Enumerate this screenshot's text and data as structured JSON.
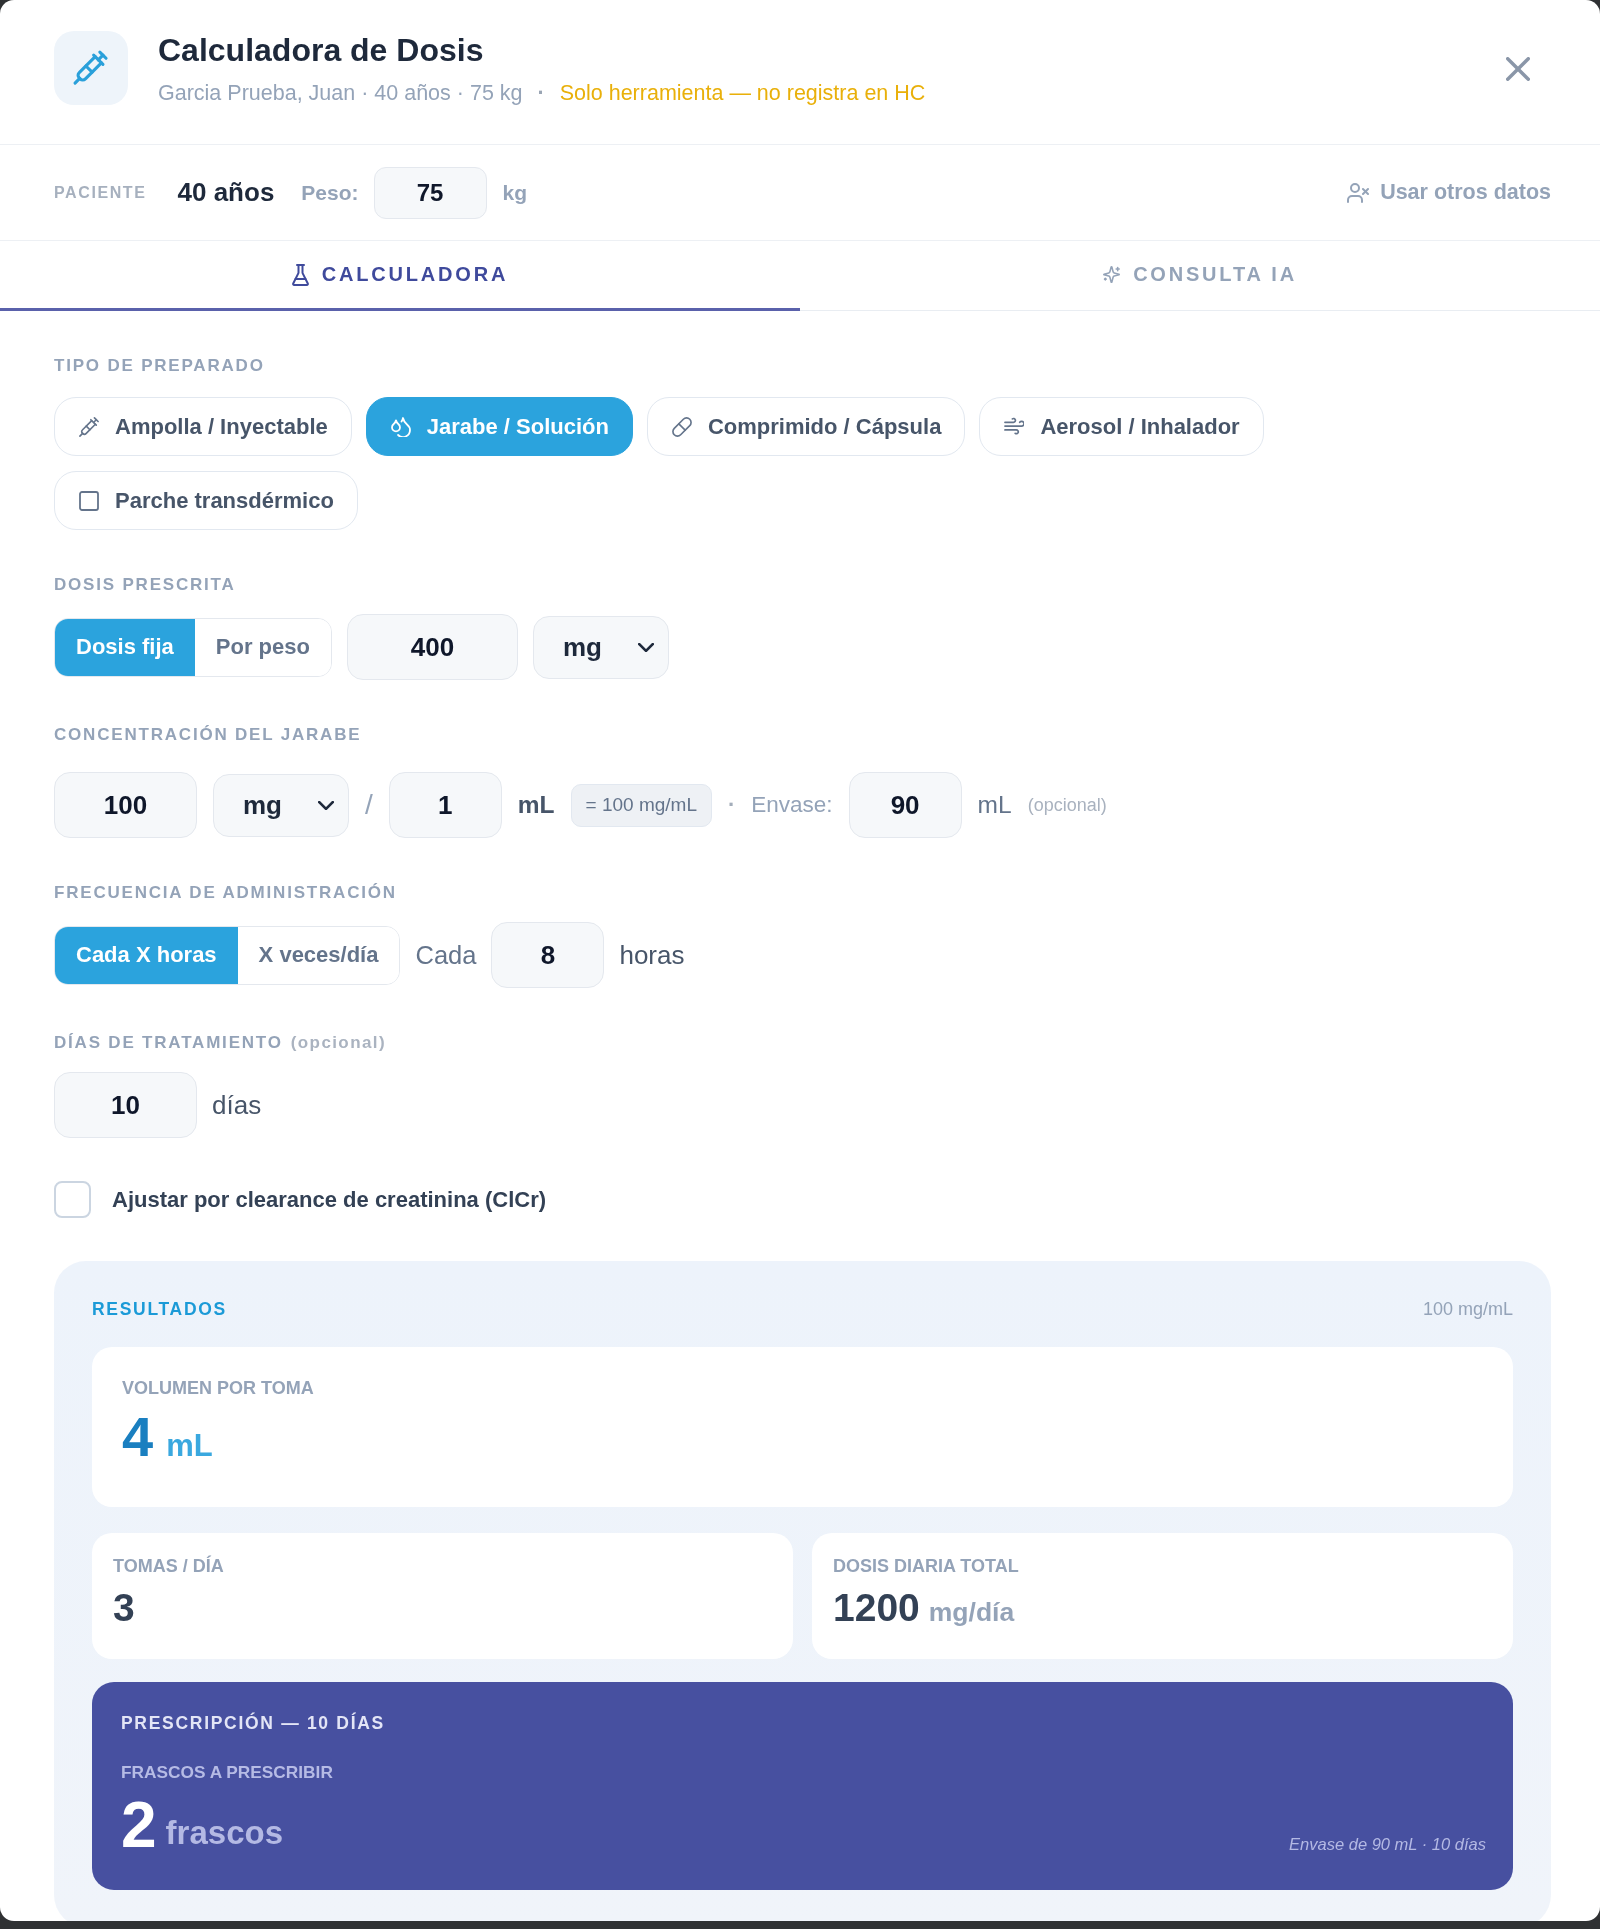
{
  "header": {
    "title": "Calculadora de Dosis",
    "patient_summary": "Garcia Prueba, Juan · 40 años · 75 kg",
    "separator": "·",
    "notice": "Solo herramienta — no registra en HC"
  },
  "patient_bar": {
    "label": "PACIENTE",
    "age": "40 años",
    "weight_label": "Peso:",
    "weight": "75",
    "weight_unit": "kg",
    "other_data_button": "Usar otros datos"
  },
  "tabs": [
    {
      "kind": "calculator",
      "label": "CALCULADORA",
      "selected": true
    },
    {
      "kind": "ai",
      "label": "CONSULTA IA",
      "selected": false
    }
  ],
  "preparation": {
    "label": "TIPO DE PREPARADO",
    "options": [
      {
        "kind": "injectable",
        "label": "Ampolla / Inyectable",
        "selected": false
      },
      {
        "kind": "syrup",
        "label": "Jarabe / Solución",
        "selected": true
      },
      {
        "kind": "tablet",
        "label": "Comprimido / Cápsula",
        "selected": false
      },
      {
        "kind": "aerosol",
        "label": "Aerosol / Inhalador",
        "selected": false
      },
      {
        "kind": "patch",
        "label": "Parche transdérmico",
        "selected": false
      }
    ]
  },
  "dose": {
    "label": "DOSIS PRESCRITA",
    "modes": [
      {
        "label": "Dosis fija",
        "selected": true
      },
      {
        "label": "Por peso",
        "selected": false
      }
    ],
    "value": "400",
    "unit": "mg"
  },
  "concentration": {
    "label": "CONCENTRACIÓN DEL JARABE",
    "amount": "100",
    "amount_unit": "mg",
    "divider": "/",
    "volume": "1",
    "volume_unit": "mL",
    "equivalence": "= 100 mg/mL",
    "separator": "·",
    "container_label": "Envase:",
    "container_volume": "90",
    "container_unit": "mL",
    "container_hint": "(opcional)"
  },
  "frequency": {
    "label": "FRECUENCIA DE ADMINISTRACIÓN",
    "modes": [
      {
        "label": "Cada X horas",
        "selected": true
      },
      {
        "label": "X veces/día",
        "selected": false
      }
    ],
    "prefix": "Cada",
    "value": "8",
    "unit": "horas"
  },
  "treatment_days": {
    "label": "DÍAS DE TRATAMIENTO",
    "hint": "(opcional)",
    "value": "10",
    "unit": "días"
  },
  "renal_adjustment": {
    "label": "Ajustar por clearance de creatinina (ClCr)",
    "checked": false
  },
  "results": {
    "title": "RESULTADOS",
    "concentration": "100 mg/mL",
    "primary": {
      "label": "VOLUMEN POR TOMA",
      "value": "4",
      "unit": "mL"
    },
    "metrics": [
      {
        "label": "TOMAS / DÍA",
        "value": "3"
      },
      {
        "label": "DOSIS DIARIA TOTAL",
        "value": "1200",
        "unit": "mg/día"
      }
    ],
    "prescription": {
      "title": "PRESCRIPCIÓN — 10 DÍAS",
      "label": "FRASCOS A PRESCRIBIR",
      "value": "2",
      "unit": "frascos",
      "note": "Envase de 90 mL · 10 días"
    }
  }
}
